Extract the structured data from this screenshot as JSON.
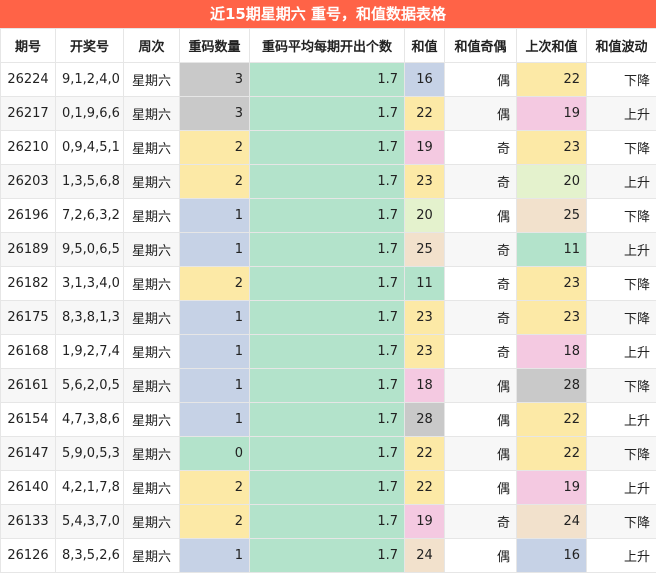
{
  "title": "近15期星期六 重号，和值数据表格",
  "colors": {
    "title_bg": "#ff6347",
    "avg_col_bg": "#b3e3cb",
    "gray": "#c9c9c9",
    "yellow": "#fce9a6",
    "blue": "#c6d2e6",
    "pink": "#f4c9e1",
    "green": "#b3e3cb",
    "lightgreen": "#e4f2cd",
    "tan": "#f2e1cc"
  },
  "headers": [
    "期号",
    "开奖号",
    "周次",
    "重码数量",
    "重码平均每期开出个数",
    "和值",
    "和值奇偶",
    "上次和值",
    "和值波动"
  ],
  "rows": [
    {
      "issue": "26224",
      "nums": "9,1,2,4,0",
      "week": "星期六",
      "repeat": "3",
      "repeat_color": "gray",
      "avg": "1.7",
      "sum": "16",
      "sum_color": "blue",
      "parity": "偶",
      "prev": "22",
      "prev_color": "yellow",
      "trend": "下降"
    },
    {
      "issue": "26217",
      "nums": "0,1,9,6,6",
      "week": "星期六",
      "repeat": "3",
      "repeat_color": "gray",
      "avg": "1.7",
      "sum": "22",
      "sum_color": "yellow",
      "parity": "偶",
      "prev": "19",
      "prev_color": "pink",
      "trend": "上升"
    },
    {
      "issue": "26210",
      "nums": "0,9,4,5,1",
      "week": "星期六",
      "repeat": "2",
      "repeat_color": "yellow",
      "avg": "1.7",
      "sum": "19",
      "sum_color": "pink",
      "parity": "奇",
      "prev": "23",
      "prev_color": "yellow",
      "trend": "下降"
    },
    {
      "issue": "26203",
      "nums": "1,3,5,6,8",
      "week": "星期六",
      "repeat": "2",
      "repeat_color": "yellow",
      "avg": "1.7",
      "sum": "23",
      "sum_color": "yellow",
      "parity": "奇",
      "prev": "20",
      "prev_color": "lightgreen",
      "trend": "上升"
    },
    {
      "issue": "26196",
      "nums": "7,2,6,3,2",
      "week": "星期六",
      "repeat": "1",
      "repeat_color": "blue",
      "avg": "1.7",
      "sum": "20",
      "sum_color": "lightgreen",
      "parity": "偶",
      "prev": "25",
      "prev_color": "tan",
      "trend": "下降"
    },
    {
      "issue": "26189",
      "nums": "9,5,0,6,5",
      "week": "星期六",
      "repeat": "1",
      "repeat_color": "blue",
      "avg": "1.7",
      "sum": "25",
      "sum_color": "tan",
      "parity": "奇",
      "prev": "11",
      "prev_color": "green",
      "trend": "上升"
    },
    {
      "issue": "26182",
      "nums": "3,1,3,4,0",
      "week": "星期六",
      "repeat": "2",
      "repeat_color": "yellow",
      "avg": "1.7",
      "sum": "11",
      "sum_color": "green",
      "parity": "奇",
      "prev": "23",
      "prev_color": "yellow",
      "trend": "下降"
    },
    {
      "issue": "26175",
      "nums": "8,3,8,1,3",
      "week": "星期六",
      "repeat": "1",
      "repeat_color": "blue",
      "avg": "1.7",
      "sum": "23",
      "sum_color": "yellow",
      "parity": "奇",
      "prev": "23",
      "prev_color": "yellow",
      "trend": "下降"
    },
    {
      "issue": "26168",
      "nums": "1,9,2,7,4",
      "week": "星期六",
      "repeat": "1",
      "repeat_color": "blue",
      "avg": "1.7",
      "sum": "23",
      "sum_color": "yellow",
      "parity": "奇",
      "prev": "18",
      "prev_color": "pink",
      "trend": "上升"
    },
    {
      "issue": "26161",
      "nums": "5,6,2,0,5",
      "week": "星期六",
      "repeat": "1",
      "repeat_color": "blue",
      "avg": "1.7",
      "sum": "18",
      "sum_color": "pink",
      "parity": "偶",
      "prev": "28",
      "prev_color": "gray",
      "trend": "下降"
    },
    {
      "issue": "26154",
      "nums": "4,7,3,8,6",
      "week": "星期六",
      "repeat": "1",
      "repeat_color": "blue",
      "avg": "1.7",
      "sum": "28",
      "sum_color": "gray",
      "parity": "偶",
      "prev": "22",
      "prev_color": "yellow",
      "trend": "上升"
    },
    {
      "issue": "26147",
      "nums": "5,9,0,5,3",
      "week": "星期六",
      "repeat": "0",
      "repeat_color": "green",
      "avg": "1.7",
      "sum": "22",
      "sum_color": "yellow",
      "parity": "偶",
      "prev": "22",
      "prev_color": "yellow",
      "trend": "下降"
    },
    {
      "issue": "26140",
      "nums": "4,2,1,7,8",
      "week": "星期六",
      "repeat": "2",
      "repeat_color": "yellow",
      "avg": "1.7",
      "sum": "22",
      "sum_color": "yellow",
      "parity": "偶",
      "prev": "19",
      "prev_color": "pink",
      "trend": "上升"
    },
    {
      "issue": "26133",
      "nums": "5,4,3,7,0",
      "week": "星期六",
      "repeat": "2",
      "repeat_color": "yellow",
      "avg": "1.7",
      "sum": "19",
      "sum_color": "pink",
      "parity": "奇",
      "prev": "24",
      "prev_color": "tan",
      "trend": "下降"
    },
    {
      "issue": "26126",
      "nums": "8,3,5,2,6",
      "week": "星期六",
      "repeat": "1",
      "repeat_color": "blue",
      "avg": "1.7",
      "sum": "24",
      "sum_color": "tan",
      "parity": "偶",
      "prev": "16",
      "prev_color": "blue",
      "trend": "上升"
    }
  ]
}
